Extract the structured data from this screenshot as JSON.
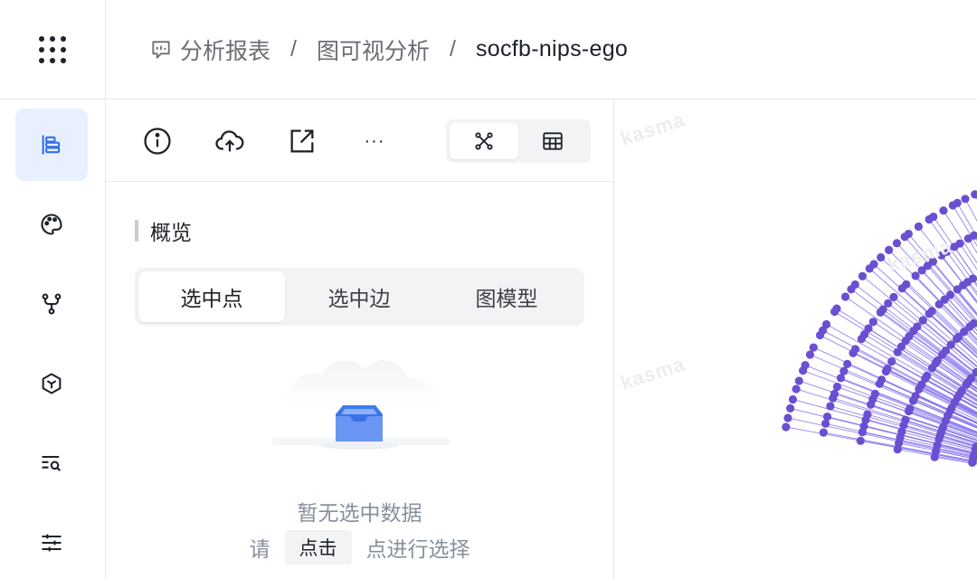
{
  "app_menu": {
    "icon": "grid-dots-icon"
  },
  "breadcrumb": {
    "items": [
      "分析报表",
      "图可视分析"
    ],
    "separator": "/",
    "current": "socfb-nips-ego"
  },
  "sidebar": {
    "items": [
      {
        "icon": "layout-list-icon",
        "active": true
      },
      {
        "icon": "palette-icon",
        "active": false
      },
      {
        "icon": "branch-icon",
        "active": false
      },
      {
        "icon": "cube-icon",
        "active": false
      },
      {
        "icon": "list-search-icon",
        "active": false
      },
      {
        "icon": "sliders-icon",
        "active": false
      }
    ]
  },
  "toolbar": {
    "buttons": [
      "info-icon",
      "upload-cloud-icon",
      "external-link-icon",
      "more-icon"
    ],
    "more_label": "···",
    "view_switch": [
      {
        "icon": "graph-view-icon",
        "active": true
      },
      {
        "icon": "table-view-icon",
        "active": false
      }
    ]
  },
  "overview": {
    "title": "概览",
    "tabs": [
      "选中点",
      "选中边",
      "图模型"
    ],
    "active_tab": 0,
    "empty_title": "暂无选中数据",
    "hint_prefix": "请",
    "hint_key": "点击",
    "hint_suffix": "点进行选择"
  },
  "canvas": {
    "watermark": "kasma",
    "node_color": "#6a4fd1",
    "edge_color": "#7b68ee"
  },
  "colors": {
    "accent": "#2f6fe8",
    "active_bg": "#e9f0fd"
  }
}
